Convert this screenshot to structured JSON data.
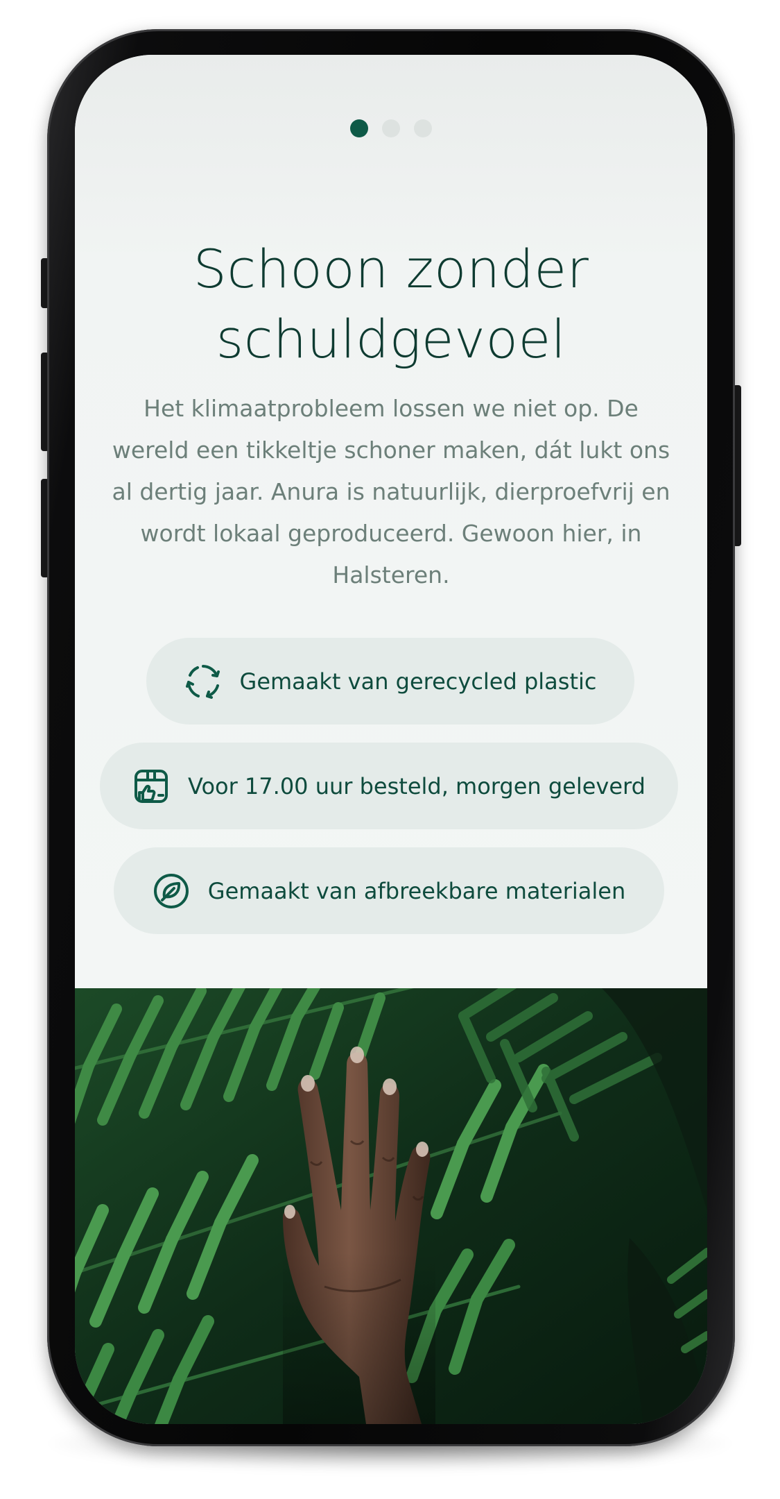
{
  "carousel": {
    "page_count": 3,
    "active_page": 1
  },
  "slide": {
    "title": "Schoon zonder schuldgevoel",
    "body": "Het klimaatprobleem lossen we niet op. De wereld een tikkeltje schoner maken, dát lukt ons al dertig jaar. Anura is natuurlijk, dierproefvrij en wordt lokaal geproduceerd. Gewoon hier, in Halsteren."
  },
  "features": [
    {
      "label": "Gemaakt van gerecycled plastic",
      "icon": "recycle-icon"
    },
    {
      "label": "Voor 17.00 uur besteld, morgen geleverd",
      "icon": "delivery-box-icon"
    },
    {
      "label": "Gemaakt van afbreekbare materialen",
      "icon": "leaf-icon"
    }
  ],
  "colors": {
    "accent": "#0e5a47",
    "title": "#0e3b31",
    "body_text": "#6c7f79",
    "pill_background": "#e4ebe9",
    "screen_background": "#f2f5f4"
  },
  "image": {
    "subject": "hand-on-fern-leaves"
  }
}
